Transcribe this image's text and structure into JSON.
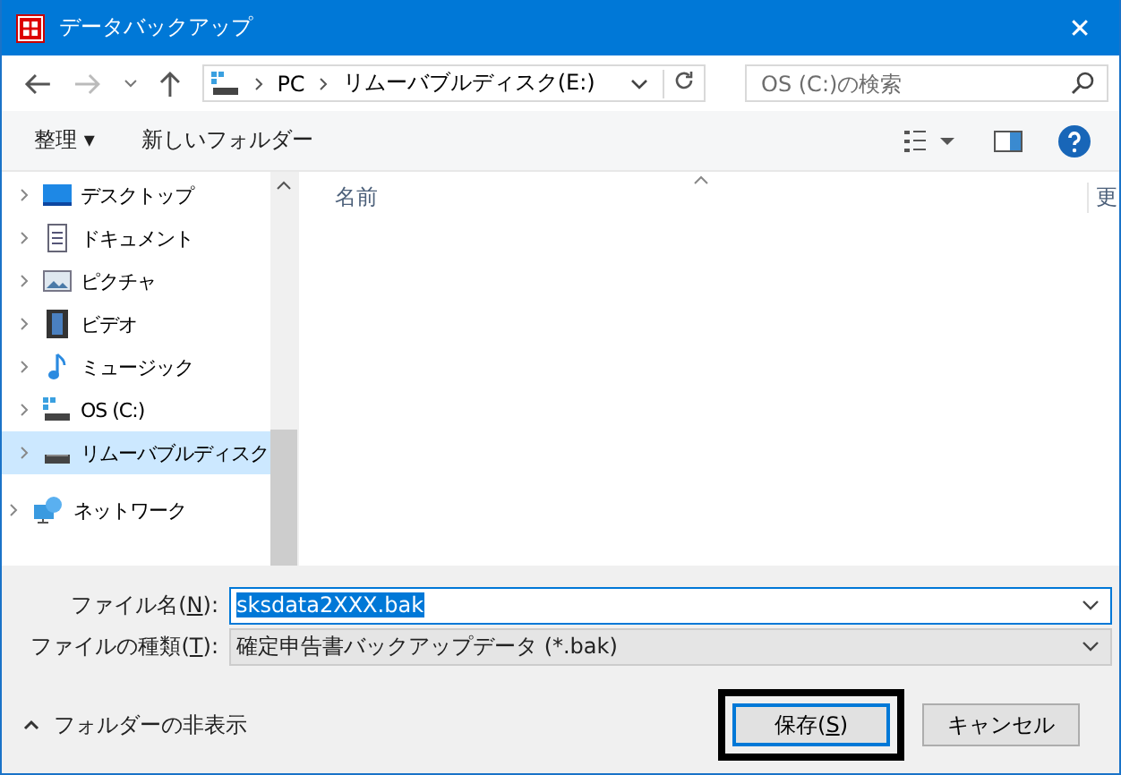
{
  "window": {
    "title": "データバックアップ",
    "close": "✕"
  },
  "address": {
    "segments": [
      "PC",
      "リムーバブルディスク(E:)"
    ]
  },
  "search": {
    "placeholder": "OS (C:)の検索"
  },
  "toolbar": {
    "organize": "整理 ▾",
    "new_folder": "新しいフォルダー"
  },
  "sidebar": {
    "items": [
      {
        "label": "デスクトップ",
        "kind": "desktop",
        "selected": false
      },
      {
        "label": "ドキュメント",
        "kind": "document",
        "selected": false
      },
      {
        "label": "ピクチャ",
        "kind": "picture",
        "selected": false
      },
      {
        "label": "ビデオ",
        "kind": "video",
        "selected": false
      },
      {
        "label": "ミュージック",
        "kind": "music",
        "selected": false
      },
      {
        "label": "OS (C:)",
        "kind": "os",
        "selected": false
      },
      {
        "label": "リムーバブルディスク",
        "kind": "drive",
        "selected": true
      },
      {
        "label": "ネットワーク",
        "kind": "network",
        "selected": false
      }
    ]
  },
  "file_list": {
    "columns": [
      "名前",
      "更"
    ]
  },
  "form": {
    "fields": [
      {
        "label_before": "ファイル名(",
        "accesskey": "N",
        "label_after": "):",
        "value": "sksdata2XXX.bak",
        "kind": "input"
      },
      {
        "label_before": "ファイルの種類(",
        "accesskey": "T",
        "label_after": "):",
        "value": "確定申告書バックアップデータ (*.bak)",
        "kind": "select"
      }
    ]
  },
  "hide_folders": "フォルダーの非表示",
  "buttons": [
    {
      "before": "保存(",
      "accesskey": "S",
      "after": ")",
      "default": true,
      "highlighted": true
    },
    {
      "before": "キャンセル",
      "default": false,
      "highlighted": false
    }
  ]
}
